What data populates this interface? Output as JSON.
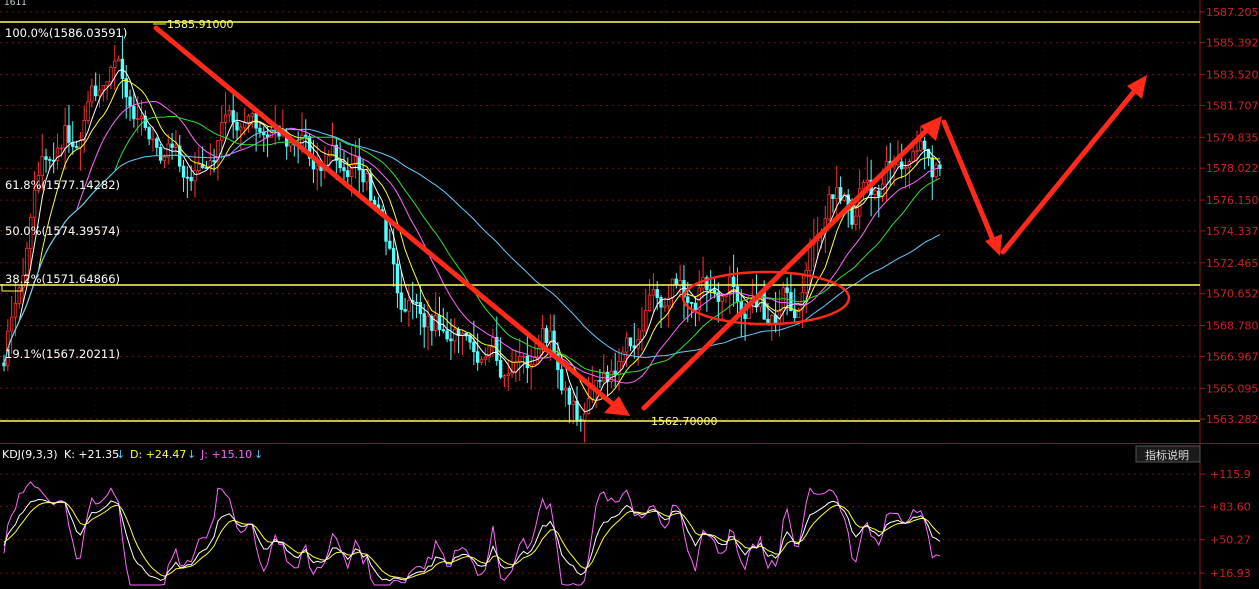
{
  "header": {
    "top_left_fragment": "1611"
  },
  "help_button": {
    "label": "指标说明"
  },
  "price_axis": {
    "labels": [
      "1587.205",
      "1585.392",
      "1583.520",
      "1581.707",
      "1579.835",
      "1578.022",
      "1576.150",
      "1574.337",
      "1572.465",
      "1570.652",
      "1568.780",
      "1566.967",
      "1565.095",
      "1563.282"
    ]
  },
  "fibonacci": {
    "levels": [
      {
        "label": "100.0%(1586.03591)",
        "value": 1586.03591
      },
      {
        "label": "61.8%(1577.14282)",
        "value": 1577.14282
      },
      {
        "label": "50.0%(1574.39574)",
        "value": 1574.39574
      },
      {
        "label": "38.2%(1571.64866)",
        "value": 1571.64866
      },
      {
        "label": "19.1%(1567.20211)",
        "value": 1567.20211
      }
    ]
  },
  "extremes": {
    "high_label": "1585.91000",
    "low_label": "1562.70000"
  },
  "kdj": {
    "title": "KDJ(9,3,3)",
    "k_label": "K: +21.35",
    "d_label": "D: +24.47",
    "j_label": "J: +15.10",
    "axis_labels": [
      "+115.9",
      "+83.60",
      "+50.27",
      "+16.93"
    ]
  },
  "colors": {
    "background": "#000000",
    "axis_text": "#cc2222",
    "grid": "#7a1010",
    "yellow_lines": "#ffff55",
    "arrow": "#ff2a1a",
    "candle_up": "#ff3030",
    "candle_down": "#54ffff",
    "k_line": "#ffffff",
    "d_line": "#ffff33",
    "j_line": "#ff66ff"
  },
  "chart_data": {
    "type": "candlestick",
    "title": "",
    "price_range": [
      1562.0,
      1587.9
    ],
    "horizontal_lines": [
      1586.03591,
      1570.65,
      1562.7
    ],
    "anchor_points": [
      {
        "bar": 0,
        "price": 1566.6
      },
      {
        "bar": 10,
        "price": 1578.5
      },
      {
        "bar": 19,
        "price": 1580.0
      },
      {
        "bar": 28,
        "price": 1584.3
      },
      {
        "bar": 38,
        "price": 1580.0
      },
      {
        "bar": 50,
        "price": 1577.4
      },
      {
        "bar": 58,
        "price": 1580.8
      },
      {
        "bar": 70,
        "price": 1580.3
      },
      {
        "bar": 80,
        "price": 1578.8
      },
      {
        "bar": 95,
        "price": 1577.7
      },
      {
        "bar": 105,
        "price": 1570.0
      },
      {
        "bar": 113,
        "price": 1568.9
      },
      {
        "bar": 120,
        "price": 1568.1
      },
      {
        "bar": 133,
        "price": 1566.3
      },
      {
        "bar": 143,
        "price": 1567.9
      },
      {
        "bar": 149,
        "price": 1563.2
      },
      {
        "bar": 152,
        "price": 1564.5
      },
      {
        "bar": 162,
        "price": 1567.0
      },
      {
        "bar": 172,
        "price": 1570.5
      },
      {
        "bar": 187,
        "price": 1570.7
      },
      {
        "bar": 202,
        "price": 1569.5
      },
      {
        "bar": 208,
        "price": 1570.3
      },
      {
        "bar": 216,
        "price": 1576.4
      },
      {
        "bar": 222,
        "price": 1575.9
      },
      {
        "bar": 232,
        "price": 1577.9
      },
      {
        "bar": 240,
        "price": 1579.4
      },
      {
        "bar": 245,
        "price": 1578.3
      }
    ],
    "fibonacci_levels": [
      1586.03591,
      1577.14282,
      1574.39574,
      1571.64866,
      1567.20211
    ],
    "kdj": {
      "k": 21.35,
      "d": 24.47,
      "j": 15.1
    },
    "kdj_range": [
      5,
      125
    ]
  }
}
